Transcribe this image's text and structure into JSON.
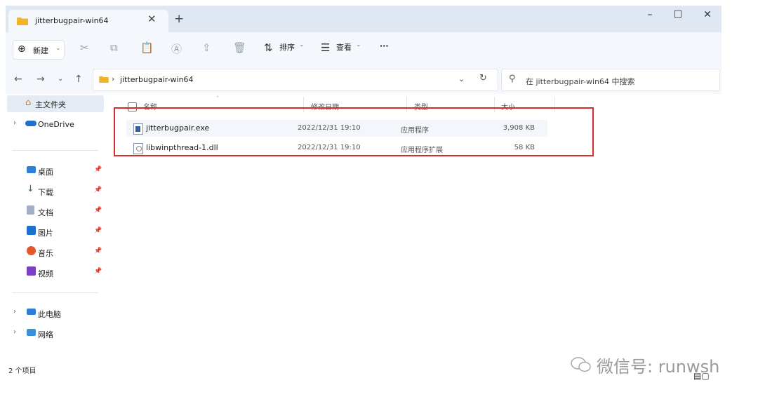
{
  "window": {
    "tab_title": "jitterbugpair-win64",
    "tab_close": "✕",
    "new_tab": "+",
    "minimize": "–",
    "maximize": "☐",
    "close": "✕"
  },
  "toolbar": {
    "new_label": "新建",
    "sort_label": "排序",
    "view_label": "查看",
    "more_label": "···"
  },
  "address": {
    "path": "jitterbugpair-win64",
    "search_placeholder": "在 jitterbugpair-win64 中搜索"
  },
  "sidebar": {
    "home": "主文件夹",
    "onedrive": "OneDrive",
    "quick_access": [
      {
        "label": "桌面"
      },
      {
        "label": "下载"
      },
      {
        "label": "文档"
      },
      {
        "label": "图片"
      },
      {
        "label": "音乐"
      },
      {
        "label": "视频"
      }
    ],
    "this_pc": "此电脑",
    "network": "网络"
  },
  "columns": {
    "name": "名称",
    "modified": "修改日期",
    "type": "类型",
    "size": "大小"
  },
  "files": [
    {
      "name": "jitterbugpair.exe",
      "modified": "2022/12/31 19:10",
      "type": "应用程序",
      "size": "3,908 KB"
    },
    {
      "name": "libwinpthread-1.dll",
      "modified": "2022/12/31 19:10",
      "type": "应用程序扩展",
      "size": "58 KB"
    }
  ],
  "status": {
    "count": "2 个项目"
  },
  "watermark": "微信号: runwsh",
  "colors": {
    "accent": "#d92a2a",
    "folder": "#f0b429",
    "titlebar": "#dfe7f2"
  }
}
